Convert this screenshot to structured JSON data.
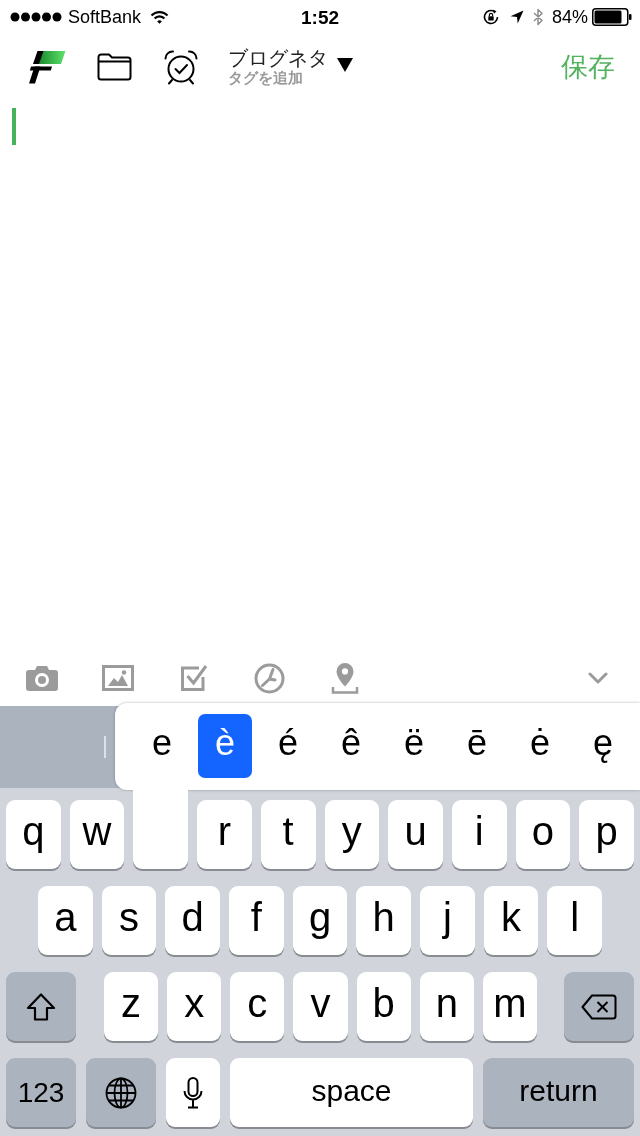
{
  "status_bar": {
    "carrier": "SoftBank",
    "time": "1:52",
    "battery": "84%"
  },
  "nav_bar": {
    "title": "ブログネタ",
    "subtitle": "タグを追加",
    "save": "保存"
  },
  "editor": {
    "focused": true
  },
  "accent_popup": {
    "options": [
      {
        "label": "e",
        "selected": false
      },
      {
        "label": "è",
        "selected": true
      },
      {
        "label": "é",
        "selected": false
      },
      {
        "label": "ê",
        "selected": false
      },
      {
        "label": "ë",
        "selected": false
      },
      {
        "label": "ē",
        "selected": false
      },
      {
        "label": "ė",
        "selected": false
      },
      {
        "label": "ę",
        "selected": false
      }
    ]
  },
  "keyboard": {
    "rows": [
      {
        "keys": [
          {
            "kind": "letter",
            "label": "q"
          },
          {
            "kind": "letter",
            "label": "w"
          },
          {
            "kind": "pressed"
          },
          {
            "kind": "letter",
            "label": "r"
          },
          {
            "kind": "letter",
            "label": "t"
          },
          {
            "kind": "letter",
            "label": "y"
          },
          {
            "kind": "letter",
            "label": "u"
          },
          {
            "kind": "letter",
            "label": "i"
          },
          {
            "kind": "letter",
            "label": "o"
          },
          {
            "kind": "letter",
            "label": "p"
          }
        ]
      },
      {
        "keys": [
          {
            "kind": "letter",
            "label": "a"
          },
          {
            "kind": "letter",
            "label": "s"
          },
          {
            "kind": "letter",
            "label": "d"
          },
          {
            "kind": "letter",
            "label": "f"
          },
          {
            "kind": "letter",
            "label": "g"
          },
          {
            "kind": "letter",
            "label": "h"
          },
          {
            "kind": "letter",
            "label": "j"
          },
          {
            "kind": "letter",
            "label": "k"
          },
          {
            "kind": "letter",
            "label": "l"
          }
        ]
      },
      {
        "keys": [
          {
            "kind": "shift"
          },
          {
            "kind": "letter",
            "label": "z"
          },
          {
            "kind": "letter",
            "label": "x"
          },
          {
            "kind": "letter",
            "label": "c"
          },
          {
            "kind": "letter",
            "label": "v"
          },
          {
            "kind": "letter",
            "label": "b"
          },
          {
            "kind": "letter",
            "label": "n"
          },
          {
            "kind": "letter",
            "label": "m"
          },
          {
            "kind": "delete"
          }
        ]
      },
      {
        "keys": [
          {
            "kind": "numbers",
            "label": "123"
          },
          {
            "kind": "globe"
          },
          {
            "kind": "mic"
          },
          {
            "kind": "space",
            "label": "space"
          },
          {
            "kind": "return",
            "label": "return"
          }
        ]
      }
    ]
  }
}
